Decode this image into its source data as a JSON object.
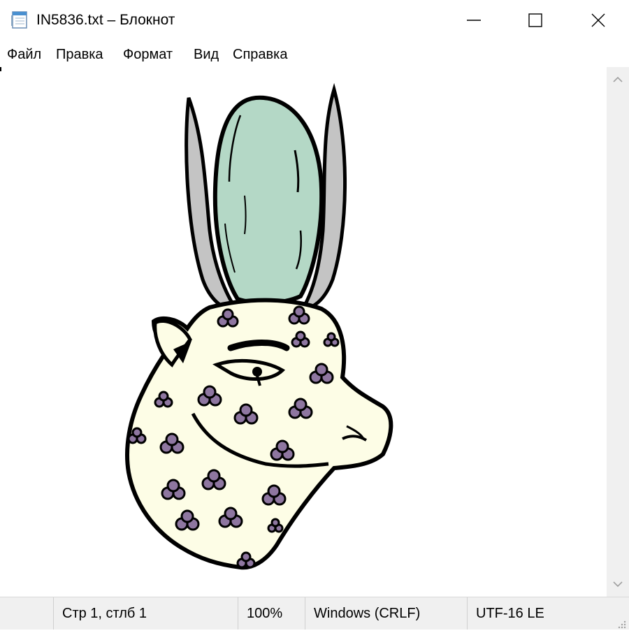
{
  "window": {
    "title": "IN5836.txt – Блокнот",
    "icons": {
      "app": "notepad-icon",
      "minimize": "minimize-icon",
      "maximize": "maximize-icon",
      "close": "close-icon"
    }
  },
  "menu": {
    "items": [
      "Файл",
      "Правка",
      "Формат",
      "Вид",
      "Справка"
    ]
  },
  "editor": {
    "content_image": "hathor-cow-head-with-sun-disk-illustration",
    "colors": {
      "face": "#fdfde6",
      "disk": "#b4d8c6",
      "horns": "#bfbfbf",
      "spots": "#8e76a0",
      "outline": "#000000"
    }
  },
  "status": {
    "position": "Стр 1, стлб 1",
    "zoom": "100%",
    "line_ending": "Windows (CRLF)",
    "encoding": "UTF-16 LE"
  }
}
